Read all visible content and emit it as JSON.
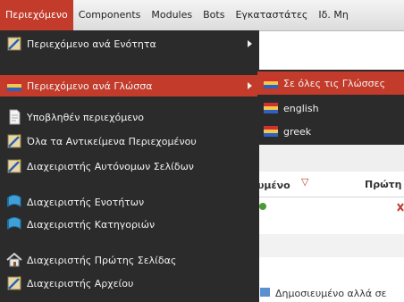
{
  "menubar": {
    "items": [
      {
        "label": "Περιεχόμενο",
        "active": true
      },
      {
        "label": "Components",
        "active": false
      },
      {
        "label": "Modules",
        "active": false
      },
      {
        "label": "Bots",
        "active": false
      },
      {
        "label": "Εγκαταστάτες",
        "active": false
      },
      {
        "label": "Ιδ. Μη",
        "active": false
      }
    ]
  },
  "dropdown": {
    "items": [
      {
        "label": "Περιεχόμενο ανά Ενότητα",
        "icon": "content-icon",
        "has_submenu": true,
        "highlight": false
      },
      {
        "label": "Περιεχόμενο ανά Γλώσσα",
        "icon": "language-flag-icon",
        "has_submenu": true,
        "highlight": true
      },
      {
        "label": "Υποβληθέν περιεχόμενο",
        "icon": "document-icon",
        "has_submenu": false,
        "highlight": false
      },
      {
        "label": "Όλα τα Αντικείμενα Περιεχομένου",
        "icon": "content-icon",
        "has_submenu": false,
        "highlight": false
      },
      {
        "label": "Διαχειριστής Αυτόνομων Σελίδων",
        "icon": "content-icon",
        "has_submenu": false,
        "highlight": false
      },
      {
        "label": "Διαχειριστής Ενοτήτων",
        "icon": "sections-icon",
        "has_submenu": false,
        "highlight": false
      },
      {
        "label": "Διαχειριστής Κατηγοριών",
        "icon": "sections-icon",
        "has_submenu": false,
        "highlight": false
      },
      {
        "label": "Διαχειριστής Πρώτης Σελίδας",
        "icon": "home-icon",
        "has_submenu": false,
        "highlight": false
      },
      {
        "label": "Διαχειριστής Αρχείου",
        "icon": "archive-icon",
        "has_submenu": false,
        "highlight": false
      }
    ]
  },
  "submenu": {
    "items": [
      {
        "label": "Σε όλες τις Γλώσσες",
        "icon": "language-flag-icon",
        "highlight": true
      },
      {
        "label": "english",
        "icon": "language-flag-icon",
        "highlight": false
      },
      {
        "label": "greek",
        "icon": "language-flag-icon",
        "highlight": false
      }
    ]
  },
  "background": {
    "col_published": "υμένο",
    "col_sort_icon": "▽",
    "col_frontpage": "Πρώτη",
    "footer_text": "Δημοσιευμένο αλλά σε"
  },
  "colors": {
    "accent": "#c23b2b",
    "menu_bg": "#2b2b2b"
  }
}
